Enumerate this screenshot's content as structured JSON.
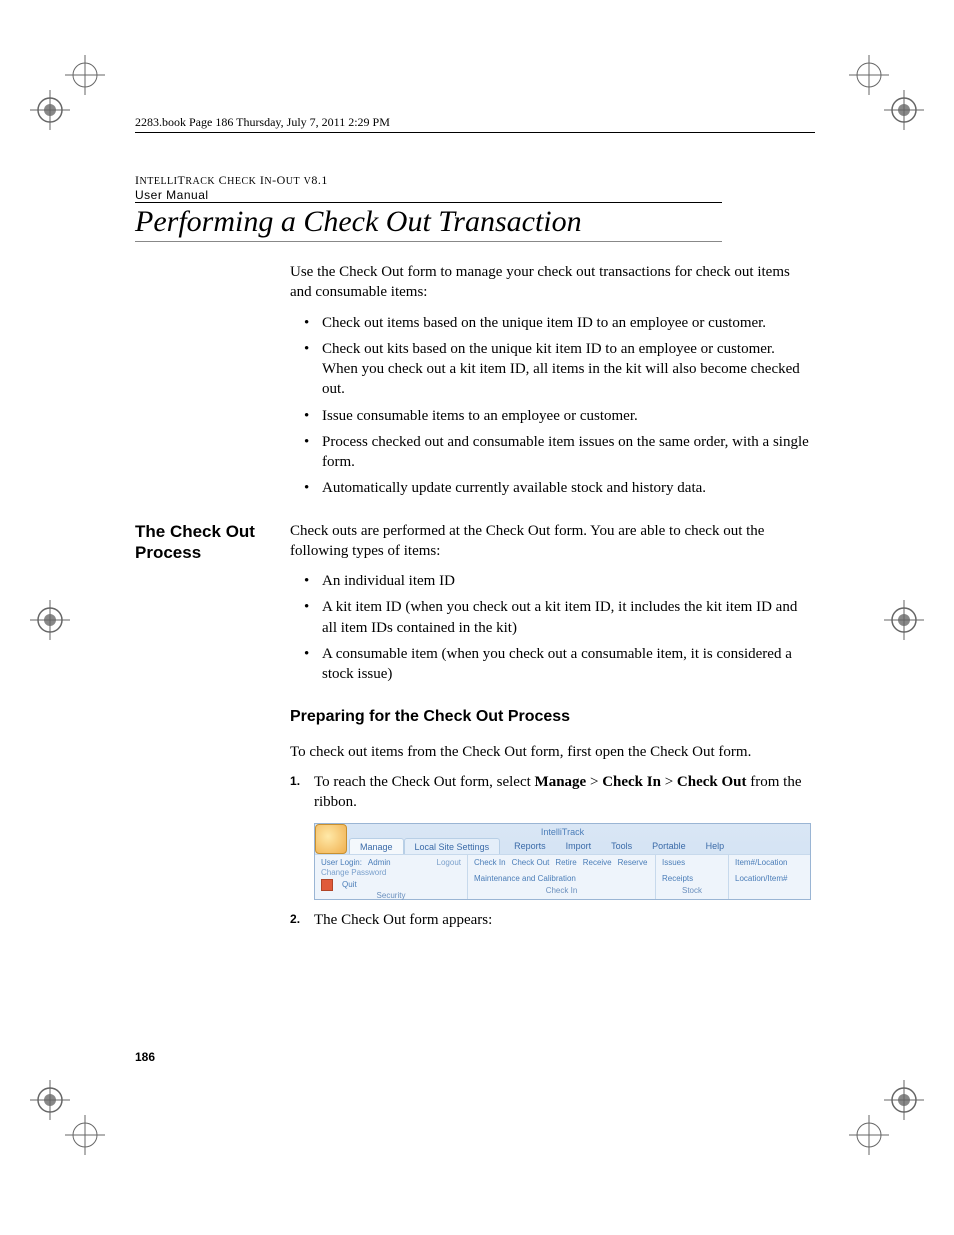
{
  "book_header": "2283.book  Page 186  Thursday, July 7, 2011  2:29 PM",
  "running_head_l1": "IntelliTrack Check In-Out v8.1",
  "running_head_l2": "User Manual",
  "section_title": "Performing a Check Out Transaction",
  "intro_para": "Use the Check Out form to manage your check out transactions for check out items and consumable items:",
  "intro_bullets": [
    "Check out items based on the unique item ID to an employee or customer.",
    "Check out kits based on the unique kit item ID to an employee or customer. When you check out a kit item ID, all items in the kit will also become checked out.",
    "Issue consumable items to an employee or customer.",
    "Process checked out and consumable item issues on the same order, with a single form.",
    "Automatically update currently available stock and history data."
  ],
  "side_heading_1": "The Check Out Process",
  "proc_para": "Check outs are performed at the Check Out form. You are able to check out the following types of items:",
  "proc_bullets": [
    "An individual item ID",
    "A kit item ID (when you check out a kit item ID, it includes the kit item ID and all item IDs contained in the kit)",
    "A consumable item (when you check out a consumable item, it is considered a stock issue)"
  ],
  "sub_heading": "Preparing for the Check Out Process",
  "prep_para": "To check out items from the Check Out form, first open the Check Out form.",
  "step1_pre": "To reach the Check Out form, select ",
  "step1_b1": "Manage",
  "step1_sep": " > ",
  "step1_b2": "Check In",
  "step1_b3": "Check Out",
  "step1_post": " from the ribbon.",
  "step2": "The Check Out form appears:",
  "page_number": "186",
  "ss": {
    "title": "IntelliTrack",
    "tabs": [
      "Manage",
      "Local Site Settings",
      "Reports",
      "Import",
      "Tools",
      "Portable",
      "Help"
    ],
    "user_login_label": "User Login:",
    "user_login_value": "Admin",
    "logout": "Logout",
    "change_pw": "Change Password",
    "quit": "Quit",
    "sec_security": "Security",
    "checkin_items": [
      "Check In",
      "Check Out",
      "Retire",
      "Receive",
      "Reserve",
      "Maintenance and Calibration"
    ],
    "sec_checkin": "Check In",
    "stock_items": [
      "Issues",
      "Receipts"
    ],
    "sec_stock": "Stock",
    "inq_items": [
      "Item#/Location",
      "Location/Item#"
    ]
  }
}
